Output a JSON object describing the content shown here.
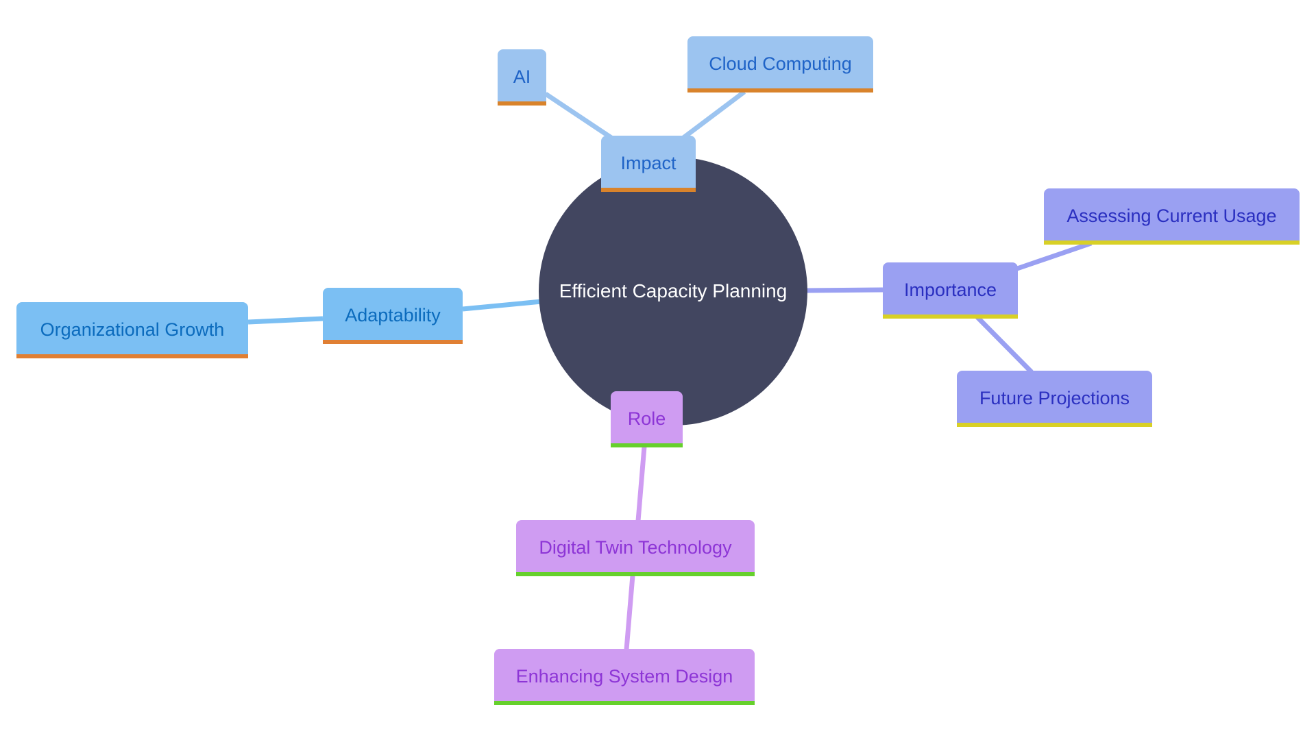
{
  "diagram": {
    "type": "mindmap",
    "root": {
      "id": "root",
      "label": "Efficient Capacity Planning",
      "fill": "#424660",
      "text_color": "#ffffff"
    },
    "branches": [
      {
        "id": "impact",
        "label": "Impact",
        "colors": {
          "fill": "#9cc4f0",
          "text": "#1f63c7",
          "accent": "#d9832b",
          "edge": "#9cc4f0"
        },
        "children": [
          {
            "id": "ai",
            "label": "AI"
          },
          {
            "id": "cloud",
            "label": "Cloud Computing"
          }
        ]
      },
      {
        "id": "adaptability",
        "label": "Adaptability",
        "colors": {
          "fill": "#7bbff3",
          "text": "#0b6bbd",
          "accent": "#e07f33",
          "edge": "#7bbff3"
        },
        "children": [
          {
            "id": "org",
            "label": "Organizational Growth"
          }
        ]
      },
      {
        "id": "importance",
        "label": "Importance",
        "colors": {
          "fill": "#9aa0f2",
          "text": "#2a2fc0",
          "accent": "#d8d026",
          "edge": "#9aa0f2"
        },
        "children": [
          {
            "id": "assessing",
            "label": "Assessing Current Usage"
          },
          {
            "id": "future",
            "label": "Future Projections"
          }
        ]
      },
      {
        "id": "role",
        "label": "Role",
        "colors": {
          "fill": "#cf9cf2",
          "text": "#8d35d6",
          "accent": "#66d02c",
          "edge": "#cf9cf2"
        },
        "children": [
          {
            "id": "digital",
            "label": "Digital Twin Technology",
            "children": [
              {
                "id": "enhancing",
                "label": "Enhancing System Design"
              }
            ]
          }
        ]
      }
    ],
    "edges": [
      {
        "from": "root",
        "to": "impact"
      },
      {
        "from": "impact",
        "to": "ai"
      },
      {
        "from": "impact",
        "to": "cloud"
      },
      {
        "from": "root",
        "to": "adaptability"
      },
      {
        "from": "adaptability",
        "to": "org"
      },
      {
        "from": "root",
        "to": "importance"
      },
      {
        "from": "importance",
        "to": "assessing"
      },
      {
        "from": "importance",
        "to": "future"
      },
      {
        "from": "root",
        "to": "role"
      },
      {
        "from": "role",
        "to": "digital"
      },
      {
        "from": "digital",
        "to": "enhancing"
      }
    ]
  }
}
